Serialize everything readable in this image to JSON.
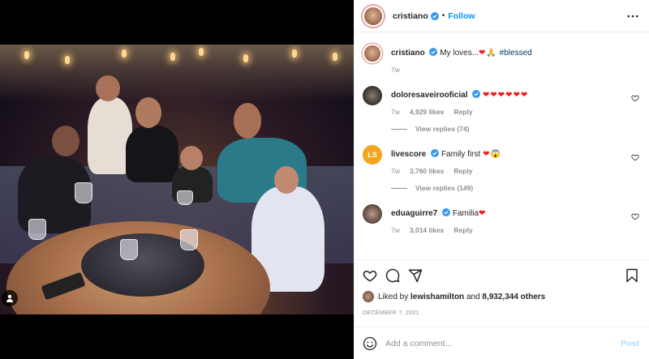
{
  "header": {
    "username": "cristiano",
    "separator": "•",
    "follow_label": "Follow"
  },
  "caption": {
    "username": "cristiano",
    "text": "My loves...",
    "emoji": "❤🙏",
    "hashtag": "#blessed",
    "time": "7w"
  },
  "comments": [
    {
      "username": "doloresaveirooficial",
      "verified": true,
      "text": "",
      "emoji": "❤❤❤❤❤❤",
      "time": "7w",
      "likes": "4,929 likes",
      "reply_label": "Reply",
      "view_replies": "View replies (74)"
    },
    {
      "username": "livescore",
      "verified": true,
      "text": "Family first",
      "emoji": "❤😱",
      "time": "7w",
      "likes": "3,760 likes",
      "reply_label": "Reply",
      "view_replies": "View replies (149)"
    },
    {
      "username": "eduaguirre7",
      "verified": true,
      "text": "Familia",
      "emoji": "❤",
      "time": "7w",
      "likes": "3,014 likes",
      "reply_label": "Reply"
    }
  ],
  "likes": {
    "prefix": "Liked by",
    "user": "lewishamilton",
    "middle": "and",
    "others": "8,932,344 others"
  },
  "date": "DECEMBER 7, 2021",
  "add_comment": {
    "placeholder": "Add a comment...",
    "post_label": "Post"
  },
  "colors": {
    "link_blue": "#0095f6",
    "hashtag": "#00376b",
    "muted": "#8e8e8e",
    "post_disabled": "#b2dffc",
    "verified": "#3897f0"
  },
  "icons": [
    "more-icon",
    "heart-icon",
    "comment-icon",
    "share-icon",
    "bookmark-icon",
    "emoji-icon",
    "user-tag-icon",
    "verified-icon"
  ]
}
